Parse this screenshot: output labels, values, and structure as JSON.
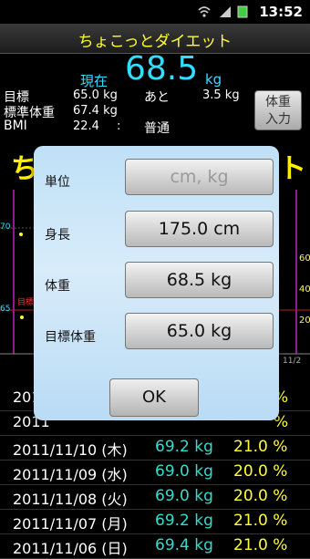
{
  "statusbar": {
    "time": "13:52"
  },
  "app": {
    "title": "ちょこっとダイエット"
  },
  "summary": {
    "current_label": "現在",
    "current_weight": "68.5",
    "current_unit": "kg",
    "goal_label": "目標",
    "goal_value": "65.0 kg",
    "remaining_label": "あと",
    "remaining_value": "3.5 kg",
    "standard_label": "標準体重",
    "standard_value": "67.4 kg",
    "bmi_label": "BMI",
    "bmi_value": "22.4",
    "bmi_sep": ":",
    "bmi_status": "普通",
    "input_button_line1": "体重",
    "input_button_line2": "入力"
  },
  "background_title": {
    "left": "ち",
    "right": "ト"
  },
  "chart": {
    "left_ticks": [
      "70",
      "65"
    ],
    "right_ticks": [
      "60",
      "40",
      "20"
    ],
    "goal_marker": "目標",
    "x_tick_partial": "11/2"
  },
  "history": [
    {
      "date": "2011",
      "weight": "",
      "percent": "%"
    },
    {
      "date": "2011",
      "weight": "",
      "percent": "%"
    },
    {
      "date": "2011/11/10 (木)",
      "weight": "69.2 kg",
      "percent": "21.0 %"
    },
    {
      "date": "2011/11/09 (水)",
      "weight": "69.0 kg",
      "percent": "20.0 %"
    },
    {
      "date": "2011/11/08 (火)",
      "weight": "69.0 kg",
      "percent": "20.0 %"
    },
    {
      "date": "2011/11/07 (月)",
      "weight": "69.2 kg",
      "percent": "21.0 %"
    },
    {
      "date": "2011/11/06 (日)",
      "weight": "69.4 kg",
      "percent": "21.0 %"
    }
  ],
  "dialog": {
    "unit_label": "単位",
    "unit_value": "cm, kg",
    "height_label": "身長",
    "height_value": "175.0 cm",
    "weight_label": "体重",
    "weight_value": "68.5 kg",
    "goal_label": "目標体重",
    "goal_value": "65.0 kg",
    "ok_label": "OK"
  }
}
